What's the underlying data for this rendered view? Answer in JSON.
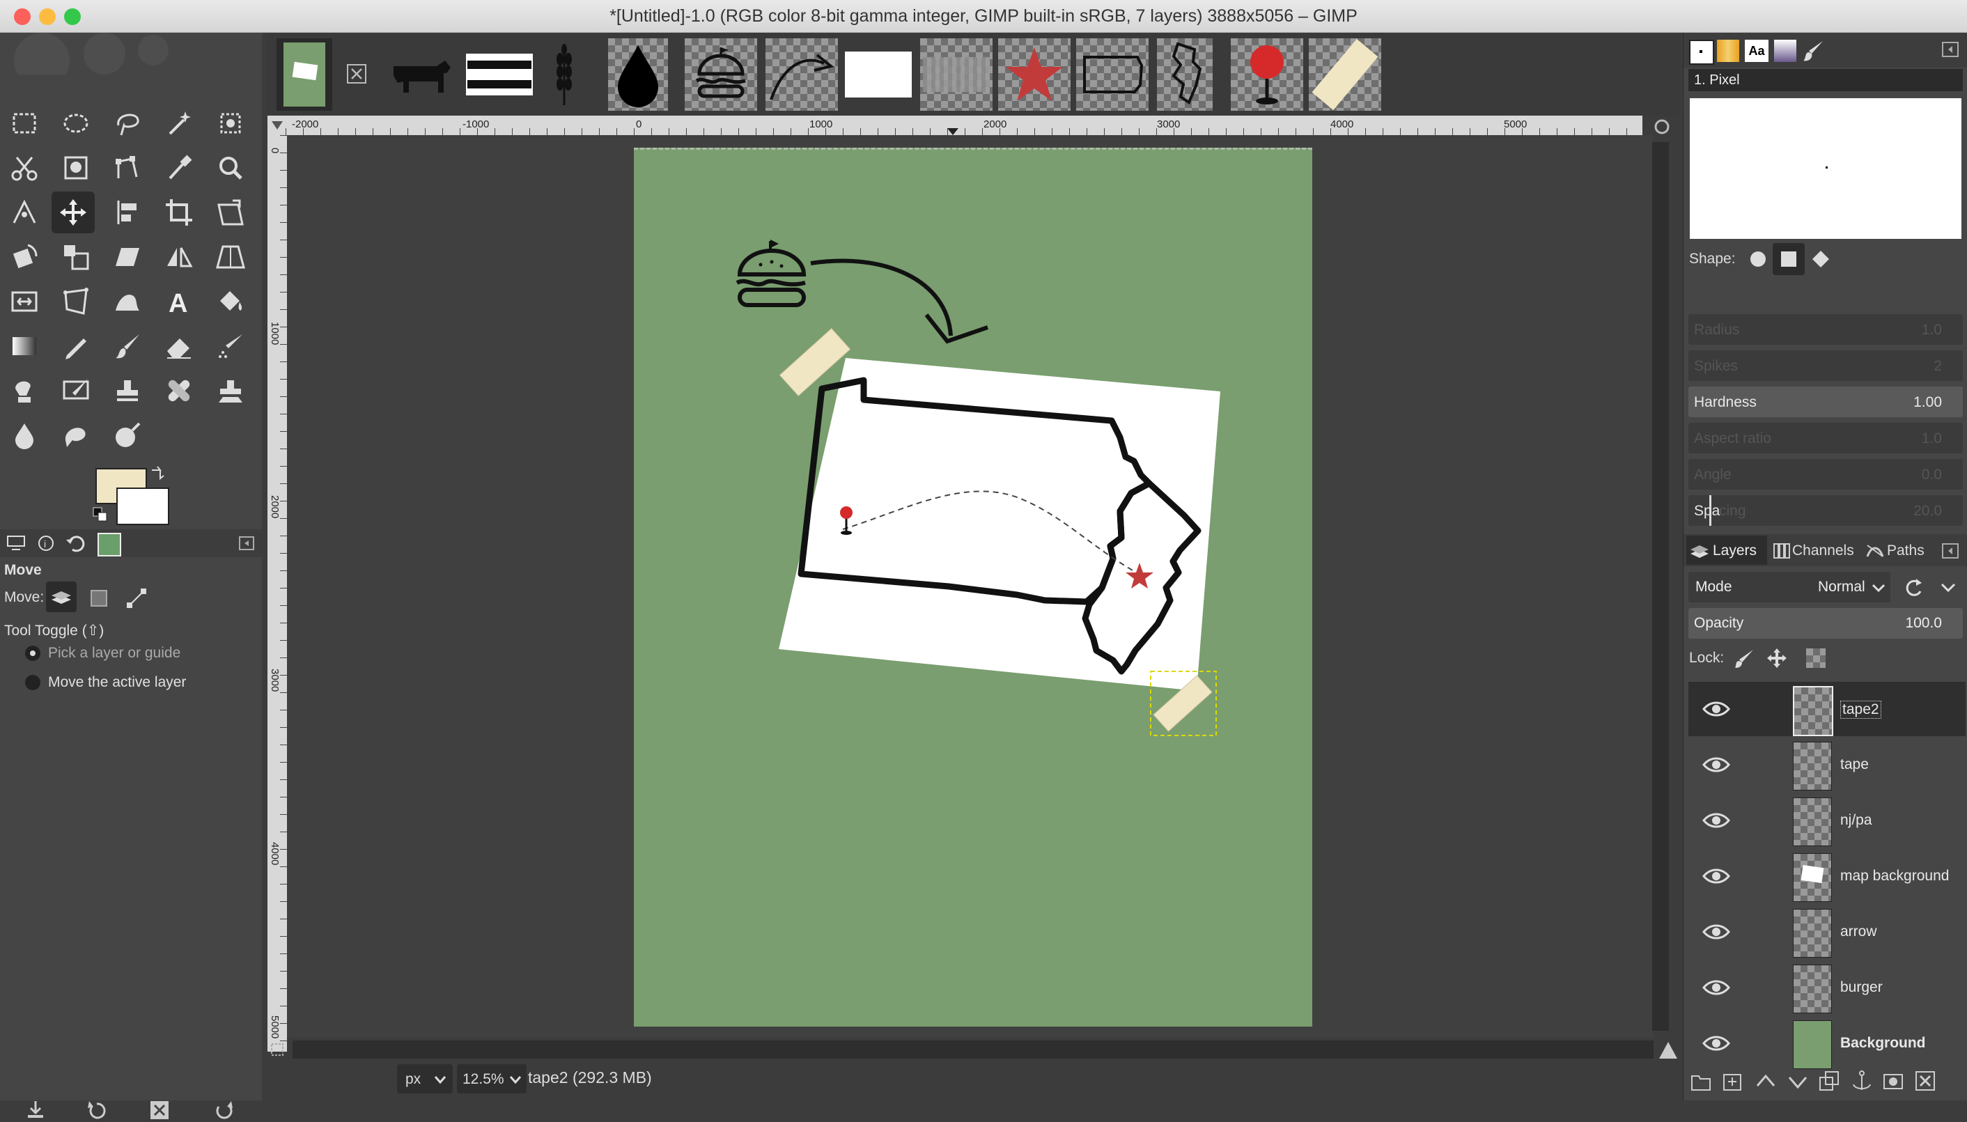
{
  "window": {
    "title": "*[Untitled]-1.0 (RGB color 8-bit gamma integer, GIMP built-in sRGB, 7 layers) 3888x5056 – GIMP"
  },
  "tool_options": {
    "tool_name": "Move",
    "move_label": "Move:",
    "tool_toggle_label": "Tool Toggle  (⇧)",
    "option_pick": "Pick a layer or guide",
    "option_move_active": "Move the active layer"
  },
  "colors": {
    "foreground": "#f0e6c4",
    "background": "#ffffff",
    "canvas_bg": "#7a9e6f"
  },
  "ruler": {
    "h_ticks": [
      "-2000",
      "-1000",
      "0",
      "1000",
      "2000",
      "3000",
      "4000",
      "5000"
    ],
    "v_ticks": [
      "0",
      "1000",
      "2000",
      "3000",
      "4000",
      "5000"
    ]
  },
  "status": {
    "unit": "px",
    "zoom": "12.5%",
    "layer_info": "tape2 (292.3 MB)"
  },
  "brush": {
    "name": "1. Pixel",
    "shape_label": "Shape:",
    "radius_label": "Radius",
    "radius_value": "1.0",
    "spikes_label": "Spikes",
    "spikes_value": "2",
    "hardness_label": "Hardness",
    "hardness_value": "1.00",
    "aspect_label": "Aspect ratio",
    "aspect_value": "1.0",
    "angle_label": "Angle",
    "angle_value": "0.0",
    "spacing_label": "Spa",
    "spacing_rest": "cing",
    "spacing_value": "20.0"
  },
  "layers_panel": {
    "tabs": [
      "Layers",
      "Channels",
      "Paths"
    ],
    "mode_label": "Mode",
    "mode_value": "Normal",
    "opacity_label": "Opacity",
    "opacity_value": "100.0",
    "lock_label": "Lock:",
    "layers": [
      {
        "name": "tape2",
        "selected": true
      },
      {
        "name": "tape",
        "selected": false
      },
      {
        "name": "nj/pa",
        "selected": false
      },
      {
        "name": "map background",
        "selected": false
      },
      {
        "name": "arrow",
        "selected": false
      },
      {
        "name": "burger",
        "selected": false
      },
      {
        "name": "Background",
        "selected": false
      }
    ]
  }
}
